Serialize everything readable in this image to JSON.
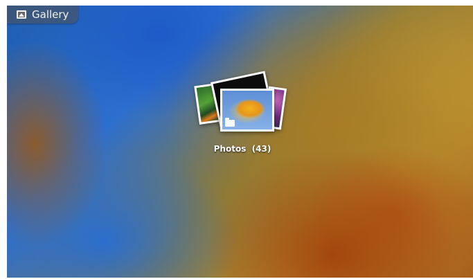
{
  "app": {
    "title": "Gallery",
    "icon": "gallery-icon"
  },
  "albums": [
    {
      "name": "Photos",
      "count_label": "(43)",
      "label": "Photos  (43)",
      "type_icon": "folder-icon"
    }
  ]
}
